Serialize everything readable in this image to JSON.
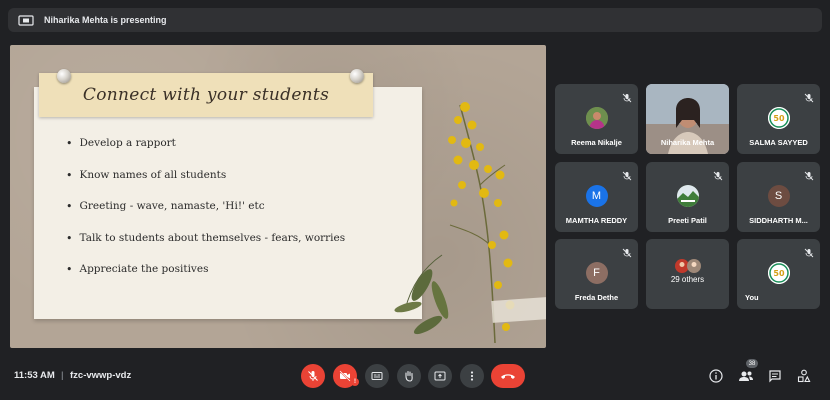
{
  "presenting_banner": {
    "text": "Niharika Mehta is presenting"
  },
  "slide": {
    "title": "Connect with your students",
    "bullets": [
      "Develop a rapport",
      "Know names of all students",
      "Greeting - wave, namaste, 'Hi!' etc",
      "Talk to students about themselves - fears, worries",
      "Appreciate the positives"
    ]
  },
  "participants": [
    {
      "name": "Reema Nikalje",
      "avatar": "photo",
      "muted": true
    },
    {
      "name": "Niharika Mehta",
      "avatar": "video",
      "muted": false
    },
    {
      "name": "SALMA SAYYED",
      "avatar": "50-logo",
      "muted": true
    },
    {
      "name": "MAMTHA REDDY",
      "avatar": "M",
      "avatar_color": "#1a73e8",
      "muted": true
    },
    {
      "name": "Preeti Patil",
      "avatar": "photo",
      "muted": true
    },
    {
      "name": "SIDDHARTH M...",
      "avatar": "S",
      "avatar_color": "#6d4c41",
      "muted": true
    },
    {
      "name": "Freda Dethe",
      "avatar": "F",
      "avatar_color": "#8d6e63",
      "muted": true
    },
    {
      "name": "29 others",
      "avatar": "group",
      "muted": false
    },
    {
      "name": "You",
      "avatar": "50-logo",
      "muted": true
    }
  ],
  "bottom_bar": {
    "time": "11:53 AM",
    "separator": "|",
    "meeting_code": "fzc-vwwp-vdz",
    "people_count": "38",
    "camera_alert": "!"
  },
  "colors": {
    "end_call": "#ea4335",
    "bar_bg": "#202124",
    "tile_bg": "#3c4043"
  }
}
